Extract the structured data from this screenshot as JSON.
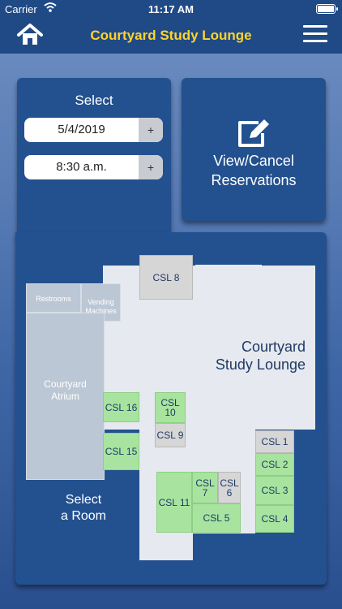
{
  "status": {
    "carrier": "Carrier",
    "time": "11:17 AM"
  },
  "nav": {
    "title": "Courtyard Study Lounge",
    "home_icon": "home-icon",
    "menu_icon": "menu-icon"
  },
  "select_panel": {
    "title": "Select",
    "date": "5/4/2019",
    "time": "8:30 a.m.",
    "stepper": "+"
  },
  "reservations": {
    "line1": "View/Cancel",
    "line2": "Reservations",
    "icon": "edit-icon"
  },
  "map": {
    "lounge_label_1": "Courtyard",
    "lounge_label_2": "Study Lounge",
    "restrooms": "Restrooms",
    "vending_1": "Vending",
    "vending_2": "Machines",
    "atrium_1": "Courtyard",
    "atrium_2": "Atrium",
    "select_room_1": "Select",
    "select_room_2": "a Room",
    "rooms": {
      "csl1": "CSL 1",
      "csl2": "CSL 2",
      "csl3": "CSL 3",
      "csl4": "CSL 4",
      "csl5": "CSL 5",
      "csl6a": "CSL",
      "csl6b": "6",
      "csl7a": "CSL",
      "csl7b": "7",
      "csl8": "CSL 8",
      "csl9": "CSL 9",
      "csl10a": "CSL",
      "csl10b": "10",
      "csl11": "CSL 11",
      "csl15": "CSL 15",
      "csl16": "CSL 16"
    }
  },
  "colors": {
    "available": "#a8e49f",
    "unavailable": "#d6d6d6",
    "title": "#ffd42a",
    "panel": "#23518f"
  }
}
